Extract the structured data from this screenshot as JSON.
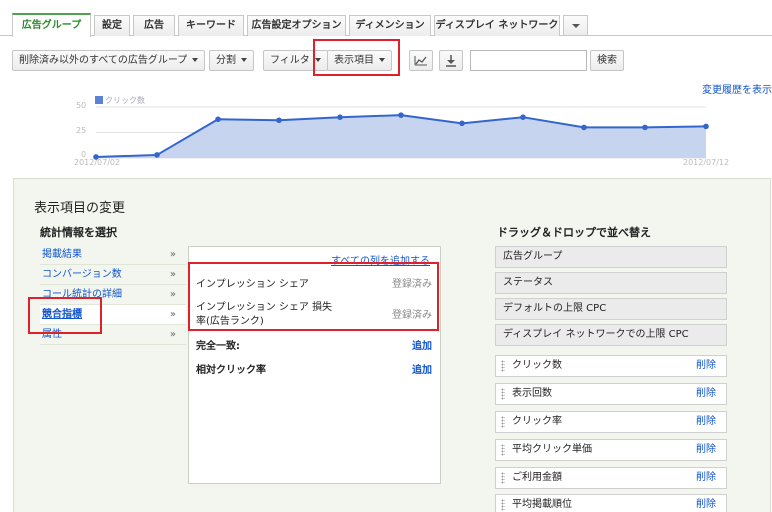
{
  "tabs": [
    {
      "label": "広告グループ",
      "active": true
    },
    {
      "label": "設定"
    },
    {
      "label": "広告"
    },
    {
      "label": "キーワード"
    },
    {
      "label": "広告設定オプション"
    },
    {
      "label": "ディメンション"
    },
    {
      "label": "ディスプレイ ネットワーク"
    }
  ],
  "toolbar": {
    "filter_all": "削除済み以外のすべての広告グループ",
    "segment": "分割",
    "filter": "フィルタ",
    "columns": "表示項目",
    "search_placeholder": "",
    "search_button": "検索",
    "change_history": "変更履歴を表示"
  },
  "chart_data": {
    "type": "area",
    "legend": "クリック数",
    "x_start_label": "2012/07/02",
    "x_end_label": "2012/07/12",
    "y_ticks": [
      "0",
      "25",
      "50"
    ],
    "ylim": [
      0,
      50
    ],
    "x": [
      "2012/07/02",
      "2012/07/03",
      "2012/07/04",
      "2012/07/05",
      "2012/07/06",
      "2012/07/07",
      "2012/07/08",
      "2012/07/09",
      "2012/07/10",
      "2012/07/11",
      "2012/07/12"
    ],
    "values": [
      1,
      3,
      38,
      37,
      40,
      42,
      34,
      40,
      30,
      30,
      31
    ],
    "color": "#3366cc",
    "fill": "#c6d4f0"
  },
  "panel": {
    "title": "表示項目の変更",
    "select_title": "統計情報を選択",
    "arrange_title": "ドラッグ＆ドロップで並べ替え"
  },
  "categories": [
    {
      "label": "掲載結果",
      "chev": "»"
    },
    {
      "label": "コンバージョン数",
      "chev": "»"
    },
    {
      "label": "コール統計の詳細",
      "chev": "»"
    },
    {
      "label": "競合指標",
      "chev": "»",
      "active": true
    },
    {
      "label": "属性",
      "chev": "»"
    }
  ],
  "metrics": {
    "add_all": "すべての列を追加する",
    "items": [
      {
        "name": "インプレッション シェア",
        "status": "登録済み"
      },
      {
        "name": "インプレッション シェア 損失率(広告ランク)",
        "name1": "インプレッション シェア 損失",
        "name2": "率(広告ランク)",
        "status": "登録済み"
      },
      {
        "name": "完全一致:",
        "action": "追加"
      },
      {
        "name": "相対クリック率",
        "action": "追加"
      }
    ]
  },
  "fixed_columns": [
    "広告グループ",
    "ステータス",
    "デフォルトの上限 CPC",
    "ディスプレイ ネットワークでの上限 CPC"
  ],
  "movable_columns": [
    {
      "label": "クリック数",
      "action": "削除"
    },
    {
      "label": "表示回数",
      "action": "削除"
    },
    {
      "label": "クリック率",
      "action": "削除"
    },
    {
      "label": "平均クリック単価",
      "action": "削除"
    },
    {
      "label": "ご利用金額",
      "action": "削除"
    },
    {
      "label": "平均掲載順位",
      "action": "削除"
    }
  ]
}
